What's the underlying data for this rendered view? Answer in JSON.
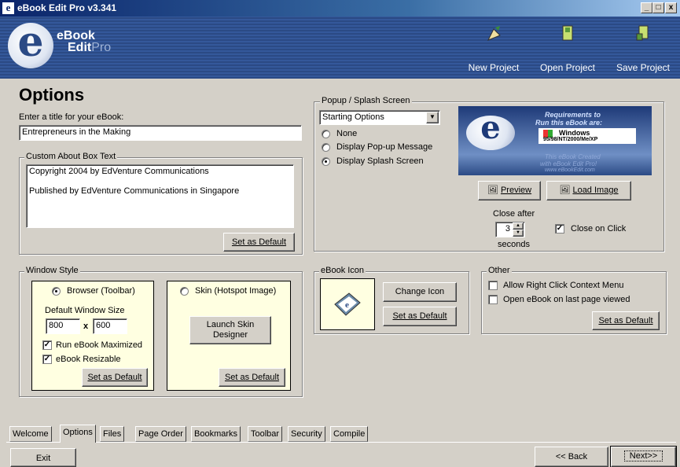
{
  "window": {
    "app_icon": "e",
    "title": "eBook Edit Pro v3.341",
    "minimize": "_",
    "maximize": "□",
    "close": "x"
  },
  "logo": {
    "line1": "eBook",
    "line2a": "Edit",
    "line2b": "Pro"
  },
  "toolbar": {
    "new_project": "New Project",
    "open_project": "Open Project",
    "save_project": "Save Project"
  },
  "page_title": "Options",
  "ebook_title": {
    "label": "Enter a title for your eBook:",
    "value": "Entrepreneurs in the Making"
  },
  "about_box": {
    "legend": "Custom About Box Text",
    "line1": "Copyright 2004 by EdVenture Communications",
    "line2": "Published by EdVenture Communications in Singapore",
    "set_default": "Set as Default"
  },
  "popup": {
    "legend": "Popup / Splash Screen",
    "selected": "Starting Options",
    "opt_none": "None",
    "opt_popup": "Display Pop-up Message",
    "opt_splash": "Display Splash Screen",
    "selected_option": "splash"
  },
  "splash_image": {
    "req1": "Requirements to",
    "req2": "Run this eBook are:",
    "windows": "Windows",
    "versions": "95/98/NT/2000/Me/XP",
    "created1": "This eBook Created",
    "created2": "with eBook Edit Pro!",
    "url": "www.eBookEdit.com"
  },
  "splash_buttons": {
    "preview": "Preview",
    "load_image": "Load Image",
    "close_after": "Close after",
    "seconds_value": "3",
    "seconds_label": "seconds",
    "close_on_click": "Close on Click",
    "close_on_click_checked": true
  },
  "window_style": {
    "legend": "Window Style",
    "browser": "Browser (Toolbar)",
    "default_size": "Default Window Size",
    "width": "800",
    "x": "x",
    "height": "600",
    "run_maximized": "Run eBook Maximized",
    "resizable": "eBook Resizable",
    "set_default": "Set as Default",
    "skin": "Skin (Hotspot Image)",
    "launch_skin": "Launch Skin Designer",
    "skin_set_default": "Set as Default"
  },
  "ebook_icon": {
    "legend": "eBook Icon",
    "change_icon": "Change Icon",
    "set_default": "Set as Default"
  },
  "other": {
    "legend": "Other",
    "right_click": "Allow Right Click Context Menu",
    "last_page": "Open eBook on last page viewed",
    "set_default": "Set as Default"
  },
  "tabs": [
    "Welcome",
    "Options",
    "Files",
    "Page Order",
    "Bookmarks",
    "Toolbar",
    "Security",
    "Compile"
  ],
  "active_tab": "Options",
  "footer": {
    "exit": "Exit",
    "back": "<< Back",
    "next": "Next>>"
  }
}
